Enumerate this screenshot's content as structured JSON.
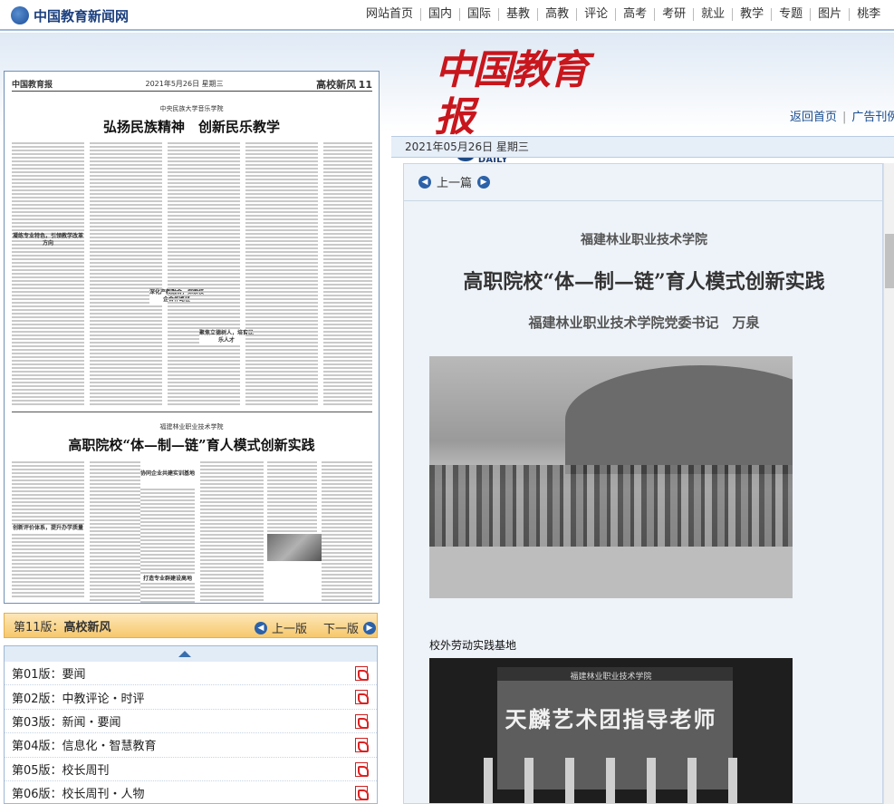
{
  "site": {
    "logo_text": "中国教育新闻网",
    "nav": [
      "网站首页",
      "国内",
      "国际",
      "基教",
      "高教",
      "评论",
      "高考",
      "考研",
      "就业",
      "教学",
      "专题",
      "图片",
      "桃李"
    ]
  },
  "masthead": {
    "title": "中国教育报",
    "subtitle": "CHINA EDUCATION DAILY",
    "links": [
      "返回首页",
      "广告刊例"
    ]
  },
  "date_bar": {
    "text": "2021年05月26日 星期三"
  },
  "paper_page": {
    "brand": "中国教育报",
    "meta": "2021年5月26日 星期三",
    "section": "高校新风",
    "page_no": "11",
    "article1_kicker": "中央民族大学音乐学院",
    "article1_title": "弘扬民族精神　创新民乐教学",
    "article2_kicker": "福建林业职业技术学院",
    "article2_title": "高职院校“体—制—链”育人模式创新实践",
    "sub1": "凝练专业特色，引领教学改革方向",
    "sub2": "深化产教融合，探索校企合作路径",
    "sub3": "聚焦立德树人，培育民乐人才",
    "sub4": "创新评价体系，提升办学质量",
    "sub5": "协同企业共建实训基地",
    "sub6": "打造专业群建设高地"
  },
  "page_nav": {
    "current_prefix": "第11版：",
    "current_name": "高校新风",
    "prev": "上一版",
    "next": "下一版"
  },
  "editions": [
    "第01版：要闻",
    "第02版：中教评论・时评",
    "第03版：新闻・要闻",
    "第04版：信息化・智慧教育",
    "第05版：校长周刊",
    "第06版：校长周刊・人物"
  ],
  "article": {
    "prev_label": "上一篇",
    "kicker": "福建林业职业技术学院",
    "title": "高职院校“体—制—链”育人模式创新实践",
    "author": "福建林业职业技术学院党委书记　万泉",
    "caption1": "校外劳动实践基地",
    "photo2_banner": "天麟艺术团指导老师",
    "photo2_header": "福建林业职业技术学院"
  }
}
